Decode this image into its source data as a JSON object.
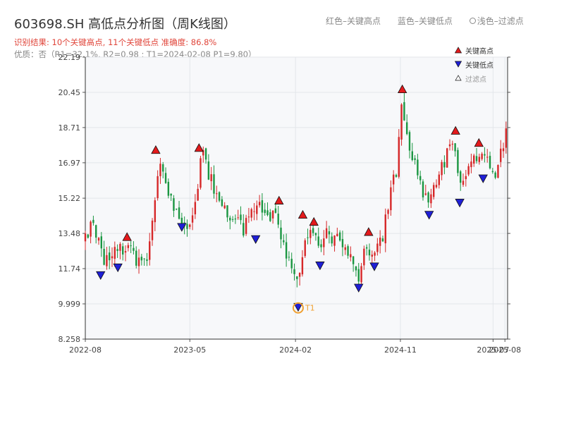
{
  "header": {
    "title": "603698.SH 高低点分析图（周K线图）",
    "result_line": "识别结果: 10个关键高点, 11个关键低点   准确度: 86.8%",
    "quality_line": "优质：否（R1=32.1%, R2=0.98 ; T1=2024-02-08 P1=9.80）"
  },
  "top_legend": {
    "red": "红色–关键高点",
    "blue": "蓝色–关键低点",
    "light": "浅色–过滤点"
  },
  "colors": {
    "up": "#d62728",
    "down": "#1a9641",
    "high_marker": "#e31a1c",
    "low_marker": "#1f1fd6",
    "t1_ring": "#f0a030",
    "plot_bg": "#f7f8fa",
    "grid": "#e3e6ea"
  },
  "chart_data": {
    "type": "candlestick",
    "ylim": [
      8.258,
      22.19
    ],
    "y_ticks": [
      "8.258",
      "9.999",
      "11.74",
      "13.48",
      "15.22",
      "16.97",
      "18.71",
      "20.45",
      "22.19"
    ],
    "y_tick_values": [
      8.258,
      9.999,
      11.74,
      13.48,
      15.22,
      16.97,
      18.71,
      20.45,
      22.19
    ],
    "x_ticks": [
      "2022-08",
      "2023-05",
      "2024-02",
      "2024-11",
      "2025-07",
      "2025-08"
    ],
    "x_tick_dates": [
      "2022-08-01",
      "2023-05-01",
      "2024-02-01",
      "2024-11-01",
      "2025-07-01",
      "2025-08-01"
    ],
    "x_range": [
      "2022-08-01",
      "2025-08-08"
    ],
    "grid": true,
    "legend_position": "top-right",
    "legend": [
      "关键高点",
      "关键低点",
      "过滤点"
    ],
    "close_path": [
      [
        "2022-08-01",
        13.1
      ],
      [
        "2022-08-20",
        13.8
      ],
      [
        "2022-09-15",
        12.3
      ],
      [
        "2022-10-25",
        12.6
      ],
      [
        "2022-11-25",
        13.2
      ],
      [
        "2022-12-15",
        12.0
      ],
      [
        "2023-01-10",
        12.2
      ],
      [
        "2023-02-15",
        17.2
      ],
      [
        "2023-03-05",
        15.5
      ],
      [
        "2023-04-05",
        14.5
      ],
      [
        "2023-04-25",
        14.0
      ],
      [
        "2023-05-15",
        15.0
      ],
      [
        "2023-06-03",
        17.4
      ],
      [
        "2023-06-25",
        16.0
      ],
      [
        "2023-08-05",
        14.6
      ],
      [
        "2023-09-01",
        14.2
      ],
      [
        "2023-09-20",
        13.7
      ],
      [
        "2023-10-15",
        14.7
      ],
      [
        "2023-11-15",
        14.8
      ],
      [
        "2023-12-20",
        13.8
      ],
      [
        "2024-01-15",
        12.0
      ],
      [
        "2024-02-08",
        10.8
      ],
      [
        "2024-02-25",
        13.5
      ],
      [
        "2024-03-15",
        14.0
      ],
      [
        "2024-04-05",
        12.6
      ],
      [
        "2024-04-25",
        13.5
      ],
      [
        "2024-05-15",
        13.2
      ],
      [
        "2024-06-10",
        12.5
      ],
      [
        "2024-07-15",
        11.4
      ],
      [
        "2024-08-01",
        13.0
      ],
      [
        "2024-08-20",
        12.3
      ],
      [
        "2024-09-15",
        13.3
      ],
      [
        "2024-10-01",
        15.0
      ],
      [
        "2024-10-20",
        16.4
      ],
      [
        "2024-11-06",
        19.8
      ],
      [
        "2024-11-25",
        17.8
      ],
      [
        "2024-12-20",
        16.0
      ],
      [
        "2025-01-10",
        15.2
      ],
      [
        "2025-01-25",
        16.0
      ],
      [
        "2025-03-01",
        17.2
      ],
      [
        "2025-03-20",
        18.2
      ],
      [
        "2025-04-05",
        16.2
      ],
      [
        "2025-04-25",
        16.5
      ],
      [
        "2025-05-15",
        17.0
      ],
      [
        "2025-06-03",
        17.7
      ],
      [
        "2025-06-20",
        16.8
      ],
      [
        "2025-07-10",
        16.6
      ],
      [
        "2025-08-08",
        18.6
      ]
    ],
    "key_highs": [
      {
        "date": "2022-11-18",
        "value": 13.3
      },
      {
        "date": "2023-02-01",
        "value": 17.6
      },
      {
        "date": "2023-05-25",
        "value": 17.7
      },
      {
        "date": "2023-12-20",
        "value": 15.1
      },
      {
        "date": "2024-02-20",
        "value": 14.4
      },
      {
        "date": "2024-03-20",
        "value": 14.05
      },
      {
        "date": "2024-08-10",
        "value": 13.55
      },
      {
        "date": "2024-11-06",
        "value": 20.6
      },
      {
        "date": "2025-03-25",
        "value": 18.55
      },
      {
        "date": "2025-05-25",
        "value": 17.95
      }
    ],
    "key_lows": [
      {
        "date": "2022-09-10",
        "value": 11.42
      },
      {
        "date": "2022-10-25",
        "value": 11.8
      },
      {
        "date": "2023-04-10",
        "value": 13.8
      },
      {
        "date": "2023-10-20",
        "value": 13.2
      },
      {
        "date": "2024-02-08",
        "value": 9.85
      },
      {
        "date": "2024-04-05",
        "value": 11.9
      },
      {
        "date": "2024-07-15",
        "value": 10.8
      },
      {
        "date": "2024-08-25",
        "value": 11.85
      },
      {
        "date": "2025-01-15",
        "value": 14.4
      },
      {
        "date": "2025-04-05",
        "value": 15.0
      },
      {
        "date": "2025-06-05",
        "value": 16.2
      }
    ],
    "t1": {
      "label": "T1",
      "date": "2024-02-08",
      "value": 9.8
    }
  }
}
